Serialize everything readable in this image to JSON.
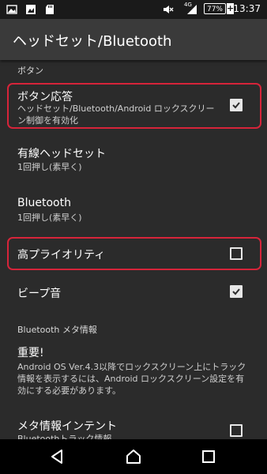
{
  "status_bar": {
    "time": "13:37",
    "battery": "77%",
    "network": "4G",
    "icons": [
      "image-icon",
      "photo-icon",
      "sd-card-icon",
      "mute-icon",
      "signal-icon",
      "battery-icon",
      "charging-icon"
    ]
  },
  "app_bar": {
    "title": "ヘッドセット/Bluetooth"
  },
  "sections": {
    "buttons_header": "ボタン",
    "bt_meta_header": "Bluetooth メタ情報"
  },
  "prefs": {
    "button_response": {
      "title": "ボタン応答",
      "summary_line1": "ヘッドセット/Bluetooth/Android ロックスクリー",
      "summary_line2": "ン制御を有効化",
      "checked": true
    },
    "wired_headset": {
      "title": "有線ヘッドセット",
      "summary": "1回押し(素早く)"
    },
    "bluetooth": {
      "title": "Bluetooth",
      "summary": "1回押し(素早く)"
    },
    "high_priority": {
      "title": "高プライオリティ",
      "checked": false
    },
    "beep": {
      "title": "ビープ音",
      "checked": true
    },
    "important": {
      "title": "重要!",
      "line1": "Android OS Ver.4.3以降でロックスクリーン上にトラック",
      "line2": "情報を表示するには、Android ロックスクリーン設定を有",
      "line3": "効にする必要があります。"
    },
    "meta_intent": {
      "title": "メタ情報インテント",
      "summary": "Bluetoothトラック情報",
      "checked": false
    }
  },
  "nav_bar": {
    "icons": [
      "back-icon",
      "home-icon",
      "recents-icon"
    ]
  },
  "colors": {
    "highlight": "#d6243a",
    "background": "#2b2b2b",
    "appbar": "#3a3a3a"
  }
}
